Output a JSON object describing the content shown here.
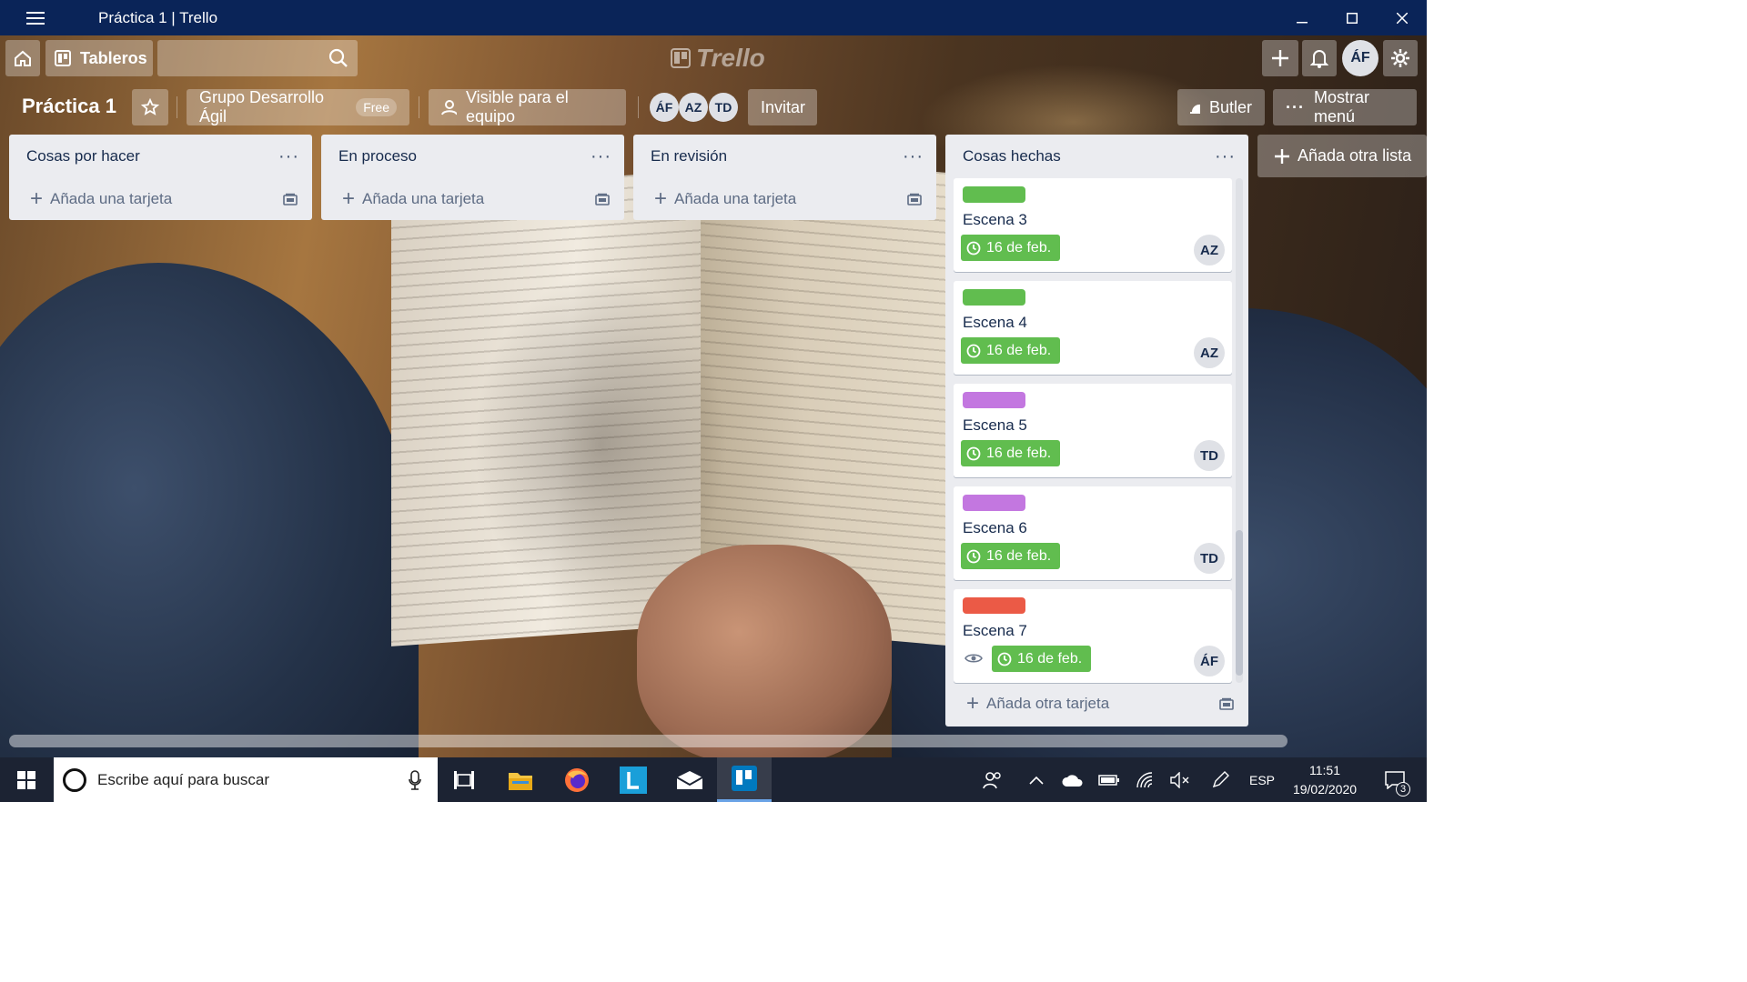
{
  "window": {
    "title": "Práctica 1 | Trello"
  },
  "header": {
    "boards_label": "Tableros",
    "logo_text": "Trello",
    "user_initials": "ÁF"
  },
  "board": {
    "title": "Práctica 1",
    "team": "Grupo Desarrollo Ágil",
    "team_badge": "Free",
    "visibility": "Visible para el equipo",
    "members": [
      "ÁF",
      "AZ",
      "TD"
    ],
    "invite_label": "Invitar",
    "butler_label": "Butler",
    "menu_label": "Mostrar menú",
    "add_list_label": "Añada otra lista"
  },
  "lists": [
    {
      "title": "Cosas por hacer",
      "add_label": "Añada una tarjeta"
    },
    {
      "title": "En proceso",
      "add_label": "Añada una tarjeta"
    },
    {
      "title": "En revisión",
      "add_label": "Añada una tarjeta"
    },
    {
      "title": "Cosas hechas",
      "add_label": "Añada otra tarjeta",
      "cards": [
        {
          "label_color": "#61bd4f",
          "title": "Escena 3",
          "due": "16 de feb.",
          "member": "AZ"
        },
        {
          "label_color": "#61bd4f",
          "title": "Escena 4",
          "due": "16 de feb.",
          "member": "AZ"
        },
        {
          "label_color": "#c377e0",
          "title": "Escena 5",
          "due": "16 de feb.",
          "member": "TD"
        },
        {
          "label_color": "#c377e0",
          "title": "Escena 6",
          "due": "16 de feb.",
          "member": "TD"
        },
        {
          "label_color": "#eb5a46",
          "title": "Escena 7",
          "due": "16 de feb.",
          "member": "ÁF",
          "watching": true
        }
      ]
    }
  ],
  "taskbar": {
    "search_placeholder": "Escribe aquí para buscar",
    "language": "ESP",
    "time": "11:51",
    "date": "19/02/2020",
    "notification_count": "3"
  }
}
